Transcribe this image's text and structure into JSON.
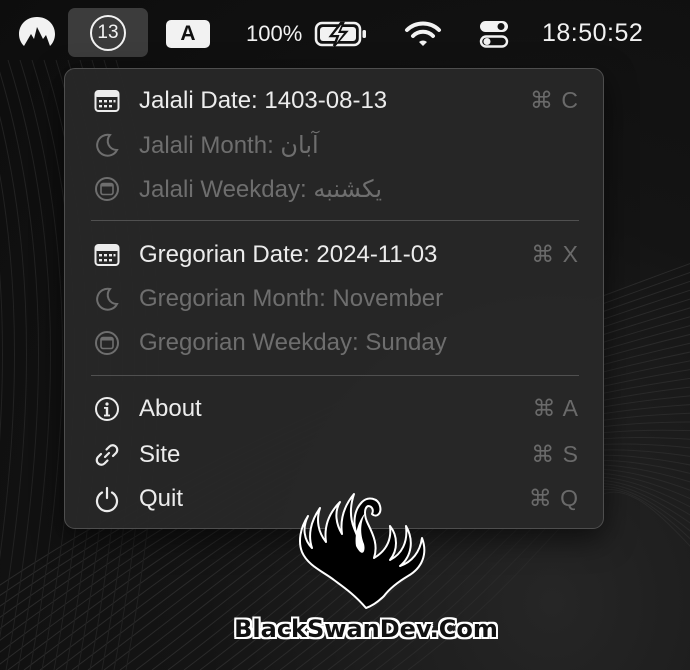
{
  "menubar": {
    "logo_icon": "nordvpn-mountain-icon",
    "date_day": "13",
    "input_source": "A",
    "battery_percent": "100%",
    "battery_icon": "battery-charging-icon",
    "wifi_icon": "wifi-icon",
    "control_center_icon": "toggle-switches-icon",
    "clock": "18:50:52"
  },
  "menu": {
    "sections": [
      {
        "items": [
          {
            "label": "Jalali Date: 1403-08-13",
            "icon": "calendar-icon",
            "shortcut": "⌘ C",
            "enabled": true
          },
          {
            "label": "Jalali Month: آبان",
            "icon": "moon-icon",
            "shortcut": "",
            "enabled": false
          },
          {
            "label": "Jalali Weekday: یکشنبه",
            "icon": "calendar-circle-icon",
            "shortcut": "",
            "enabled": false
          }
        ]
      },
      {
        "items": [
          {
            "label": "Gregorian Date: 2024-11-03",
            "icon": "calendar-icon",
            "shortcut": "⌘ X",
            "enabled": true
          },
          {
            "label": "Gregorian Month: November",
            "icon": "moon-icon",
            "shortcut": "",
            "enabled": false
          },
          {
            "label": "Gregorian Weekday: Sunday",
            "icon": "calendar-circle-icon",
            "shortcut": "",
            "enabled": false
          }
        ]
      },
      {
        "items": [
          {
            "label": "About",
            "icon": "info-icon",
            "shortcut": "⌘ A",
            "enabled": true
          },
          {
            "label": "Site",
            "icon": "link-icon",
            "shortcut": "⌘ S",
            "enabled": true
          },
          {
            "label": "Quit",
            "icon": "power-icon",
            "shortcut": "⌘ Q",
            "enabled": true
          }
        ]
      }
    ]
  },
  "watermark": {
    "text": "BlackSwanDev.Com",
    "logo_icon": "black-swan-logo-icon"
  },
  "colors": {
    "background": "#141414",
    "menu_background": "#282828",
    "text": "#ececec",
    "disabled_text": "#6e6e6e",
    "shortcut": "#6a6a6a"
  }
}
